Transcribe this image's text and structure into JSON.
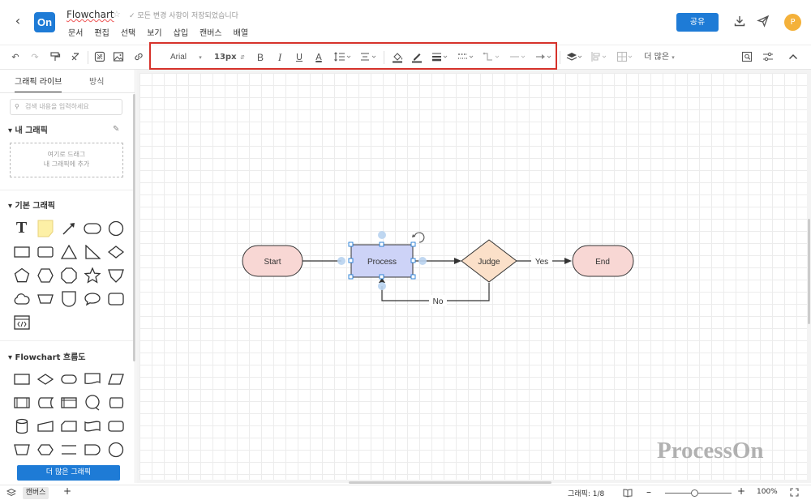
{
  "header": {
    "back_icon": "chevron-left-icon",
    "logo": "On",
    "title": "Flowchart",
    "saved_status": "모든 변경 사항이 저장되었습니다",
    "menus": [
      "문서",
      "편집",
      "선택",
      "보기",
      "삽입",
      "캔버스",
      "배열"
    ],
    "share_label": "공유",
    "avatar_initial": "P",
    "accent": "#1e7bd6"
  },
  "toolbar": {
    "font_family": "Arial",
    "font_size": "13px",
    "bold": "B",
    "italic": "I",
    "underline": "U",
    "font_color": "A",
    "more_label": "더 많은",
    "highlight_color": "#d6322b"
  },
  "sidebar": {
    "tabs": [
      "그래픽 라이브",
      "방식"
    ],
    "search_placeholder": "검색 내용을 입력하세요",
    "my_graphics_title": "내 그래픽",
    "drop_text_1": "여기로 드래그",
    "drop_text_2": "내 그래픽에 추가",
    "basic_title": "기본 그래픽",
    "text_tool": "T",
    "flowchart_title": "Flowchart 흐름도",
    "more_graphics_label": "더 많은 그래픽"
  },
  "diagram": {
    "start": "Start",
    "process": "Process",
    "judge": "Judge",
    "end": "End",
    "yes_label": "Yes",
    "no_label": "No",
    "colors": {
      "terminal_fill": "#f8d7d4",
      "terminal_stroke": "#333333",
      "process_fill": "#cdd3f7",
      "process_stroke": "#333333",
      "decision_fill": "#fbe0c9",
      "selection": "#1e7bd6"
    }
  },
  "watermark": "ProcessOn",
  "status": {
    "page_tab": "캔버스",
    "graphics_count": "그래픽: 1/8",
    "zoom": "100%"
  }
}
